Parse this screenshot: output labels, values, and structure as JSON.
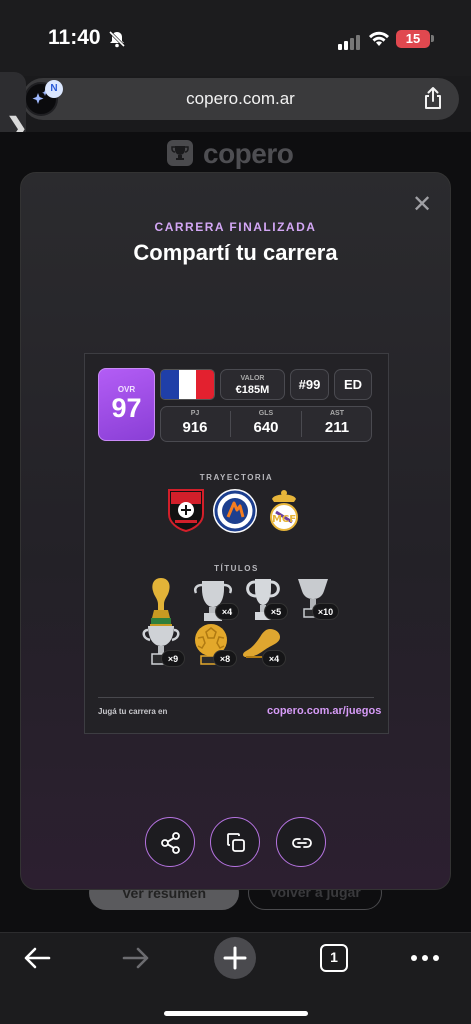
{
  "status_bar": {
    "time": "11:40",
    "battery": "15",
    "battery_color": "#e0484f"
  },
  "browser": {
    "url": "copero.com.ar",
    "extension_badge": "N",
    "side_chevron": "❯"
  },
  "page": {
    "brand": "copero",
    "btn_resumen": "Ver resumen",
    "btn_volver": "Volver a jugar"
  },
  "modal": {
    "eyebrow": "CARRERA FINALIZADA",
    "title": "Compartí tu carrera",
    "close": "✕",
    "card": {
      "ovr_label": "OVR",
      "ovr_value": "97",
      "ovr_color": "#a64de8",
      "nationality_flag": "france-flag-icon",
      "valor_label": "VALOR",
      "valor_value": "€185M",
      "shirt_number": "#99",
      "position": "ED",
      "stats": [
        {
          "label": "PJ",
          "value": "916"
        },
        {
          "label": "GLS",
          "value": "640"
        },
        {
          "label": "AST",
          "value": "211"
        }
      ],
      "trayectoria_label": "TRAYECTORIA",
      "clubs": [
        "stade-rennais-crest-icon",
        "montpellier-crest-icon",
        "real-madrid-crest-icon"
      ],
      "titulos_label": "TÍTULOS",
      "titles": [
        {
          "icon": "world-cup-trophy-icon",
          "count": ""
        },
        {
          "icon": "euro-trophy-icon",
          "count": "×4"
        },
        {
          "icon": "champions-league-trophy-icon",
          "count": "×5"
        },
        {
          "icon": "league-trophy-icon",
          "count": "×10"
        },
        {
          "icon": "cup-trophy-icon",
          "count": "×9"
        },
        {
          "icon": "ballon-dor-icon",
          "count": "×8"
        },
        {
          "icon": "golden-boot-icon",
          "count": "×4"
        }
      ],
      "footer_left": "Jugá tu carrera en",
      "footer_right": "copero.com.ar/juegos",
      "accent": "#d69bf7"
    },
    "actions": [
      "share-icon",
      "copy-icon",
      "link-icon"
    ]
  },
  "toolbar": {
    "tab_count": "1"
  }
}
